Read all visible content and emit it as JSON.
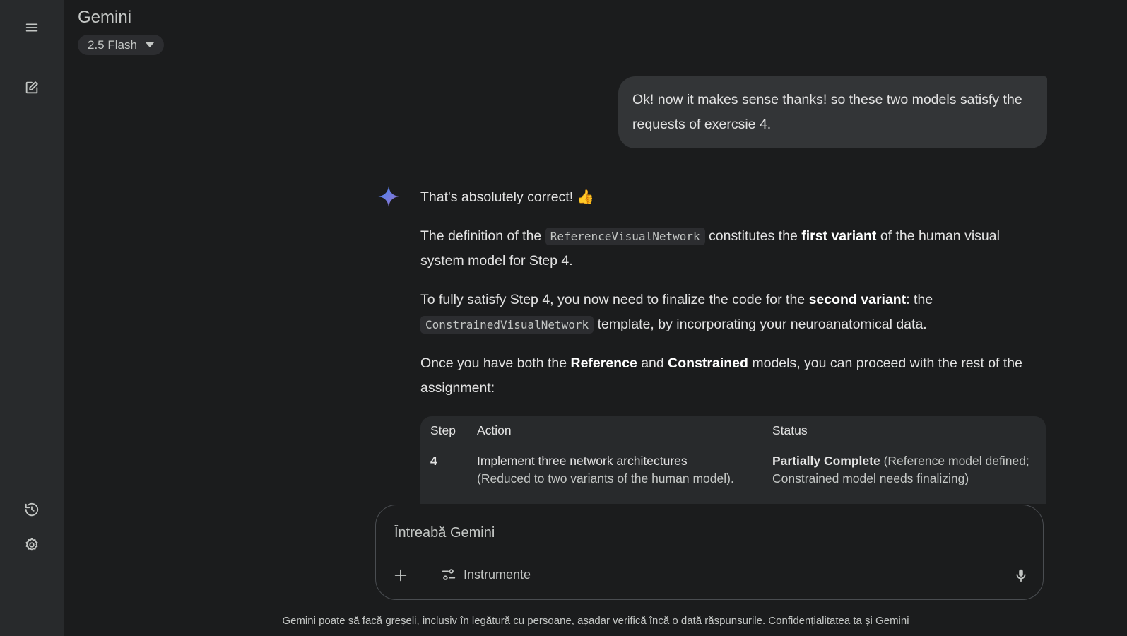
{
  "app": {
    "title": "Gemini",
    "model_label": "2.5 Flash"
  },
  "user_message": "Ok! now it makes sense thanks! so these two models satisfy the requests of exercsie 4.",
  "response": {
    "p1": {
      "text": "That's absolutely correct!",
      "emoji": "👍"
    },
    "p2": {
      "t1": "The definition of the ",
      "code": "ReferenceVisualNetwork",
      "t2": " constitutes the ",
      "b1": "first variant",
      "t3": " of the human visual system model for Step 4."
    },
    "p3": {
      "t1": "To fully satisfy Step 4, you now need to finalize the code for the ",
      "b1": "second variant",
      "t2": ": the ",
      "code": "ConstrainedVisualNetwork",
      "t3": " template, by incorporating your neuroanatomical data."
    },
    "p4": {
      "t1": "Once you have both the ",
      "b1": "Reference",
      "t2": " and ",
      "b2": "Constrained",
      "t3": " models, you can proceed with the rest of the assignment:"
    }
  },
  "table": {
    "headers": [
      "Step",
      "Action",
      "Status"
    ],
    "rows": [
      {
        "step": "4",
        "action": "Implement three network architectures",
        "action_sub": "(Reduced to two variants of the human model).",
        "status_bold": "Partially Complete",
        "status_rest": " (Reference model defined; Constrained model needs finalizing)"
      }
    ]
  },
  "composer": {
    "placeholder": "Întreabă Gemini",
    "tools_label": "Instrumente"
  },
  "footer": {
    "disclaimer": "Gemini poate să facă greșeli, inclusiv în legătură cu persoane, așadar verifică încă o dată răspunsurile.",
    "link": "Confidențialitatea ta și Gemini"
  },
  "colors": {
    "background": "#1b1c1d",
    "rail": "#282a2c",
    "bubble": "#333537",
    "spark_start": "#4285f4",
    "spark_end": "#9b72cb"
  },
  "icons": [
    "menu-icon",
    "new-chat-icon",
    "history-icon",
    "settings-icon",
    "gemini-spark-icon",
    "thumbs-up-emoji",
    "plus-icon",
    "tools-icon",
    "mic-icon",
    "chevron-down-icon"
  ]
}
